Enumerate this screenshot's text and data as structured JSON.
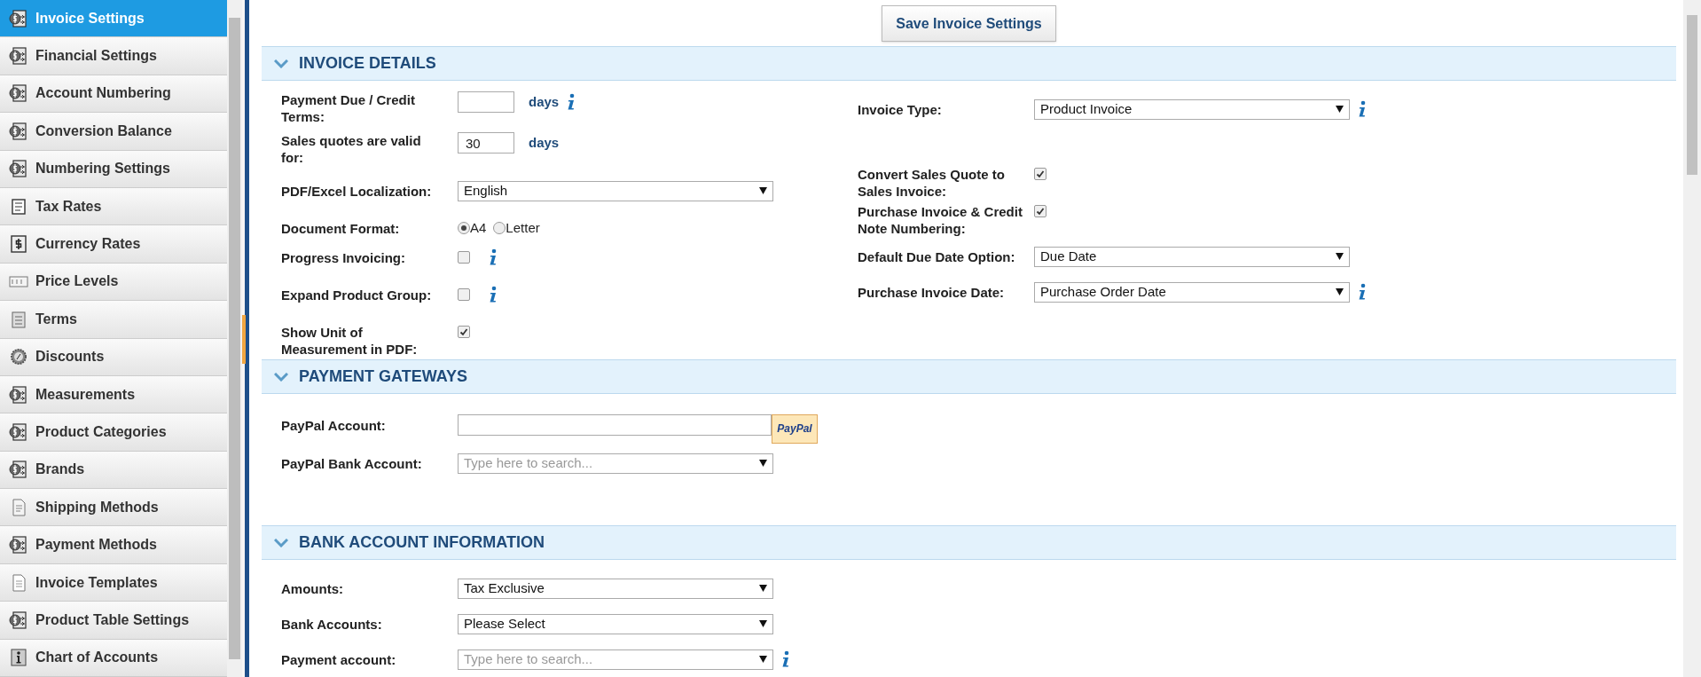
{
  "sidebar": {
    "items": [
      {
        "label": "Invoice Settings",
        "kind": "dollar",
        "selected": true
      },
      {
        "label": "Financial Settings",
        "kind": "dollar",
        "selected": false
      },
      {
        "label": "Account Numbering",
        "kind": "dollar",
        "selected": false
      },
      {
        "label": "Conversion Balance",
        "kind": "dollar",
        "selected": false
      },
      {
        "label": "Numbering Settings",
        "kind": "dollar",
        "selected": false
      },
      {
        "label": "Tax Rates",
        "kind": "list",
        "selected": false
      },
      {
        "label": "Currency Rates",
        "kind": "currency",
        "selected": false
      },
      {
        "label": "Price Levels",
        "kind": "price",
        "selected": false
      },
      {
        "label": "Terms",
        "kind": "terms",
        "selected": false
      },
      {
        "label": "Discounts",
        "kind": "discount",
        "selected": false
      },
      {
        "label": "Measurements",
        "kind": "dollar",
        "selected": false
      },
      {
        "label": "Product Categories",
        "kind": "dollar",
        "selected": false
      },
      {
        "label": "Brands",
        "kind": "dollar",
        "selected": false
      },
      {
        "label": "Shipping Methods",
        "kind": "shipping",
        "selected": false
      },
      {
        "label": "Payment Methods",
        "kind": "dollar",
        "selected": false
      },
      {
        "label": "Invoice Templates",
        "kind": "template",
        "selected": false
      },
      {
        "label": "Product Table Settings",
        "kind": "dollar",
        "selected": false
      },
      {
        "label": "Chart of Accounts",
        "kind": "chart",
        "selected": false
      }
    ]
  },
  "save_button": "Save Invoice Settings",
  "sections": [
    {
      "title": "INVOICE DETAILS",
      "expanded": true,
      "left": [
        {
          "kind": "number",
          "label": "Payment Due / Credit Terms:",
          "suffix": "days",
          "info": true
        },
        {
          "kind": "number",
          "label": "Sales quotes are valid for:",
          "value": "30",
          "suffix": "days",
          "info": false
        },
        {
          "kind": "select",
          "label": "PDF/Excel Localization:",
          "value": "English",
          "info": false
        },
        {
          "kind": "radio",
          "label": "Document Format:",
          "options": [
            {
              "label": "A4",
              "selected": true
            },
            {
              "label": "Letter",
              "selected": false
            }
          ]
        },
        {
          "kind": "checkbox",
          "label": "Progress Invoicing:",
          "checked": false,
          "info": true
        },
        {
          "kind": "checkbox",
          "label": "Expand Product Group:",
          "checked": false,
          "info": true
        },
        {
          "kind": "checkbox",
          "label": "Show Unit of Measurement in PDF:",
          "checked": true,
          "info": false
        }
      ],
      "right": [
        {
          "kind": "select",
          "label": "Invoice Type:",
          "value": "Product Invoice",
          "info": true
        },
        {
          "kind": "spacer"
        },
        {
          "kind": "checkbox",
          "label": "Convert Sales Quote to Sales Invoice:",
          "checked": true,
          "info": false
        },
        {
          "kind": "checkbox",
          "label": "Purchase Invoice & Credit Note Numbering:",
          "checked": true,
          "info": false
        },
        {
          "kind": "select",
          "label": "Default Due Date Option:",
          "value": "Due Date",
          "info": false
        },
        {
          "kind": "select",
          "label": "Purchase Invoice Date:",
          "value": "Purchase Order Date",
          "info": true
        }
      ]
    },
    {
      "title": "PAYMENT GATEWAYS",
      "expanded": true,
      "left": [
        {
          "kind": "paypal",
          "label": "PayPal Account:",
          "button": "PayPal"
        },
        {
          "kind": "select",
          "label": "PayPal Bank Account:",
          "placeholder": "Type here to search...",
          "info": false
        }
      ]
    },
    {
      "title": "BANK ACCOUNT INFORMATION",
      "expanded": true,
      "left": [
        {
          "kind": "select",
          "label": "Amounts:",
          "value": "Tax Exclusive",
          "info": false
        },
        {
          "kind": "select",
          "label": "Bank Accounts:",
          "value": "Please Select",
          "info": false
        },
        {
          "kind": "select",
          "label": "Payment account:",
          "placeholder": "Type here to search...",
          "info": true
        }
      ]
    }
  ]
}
